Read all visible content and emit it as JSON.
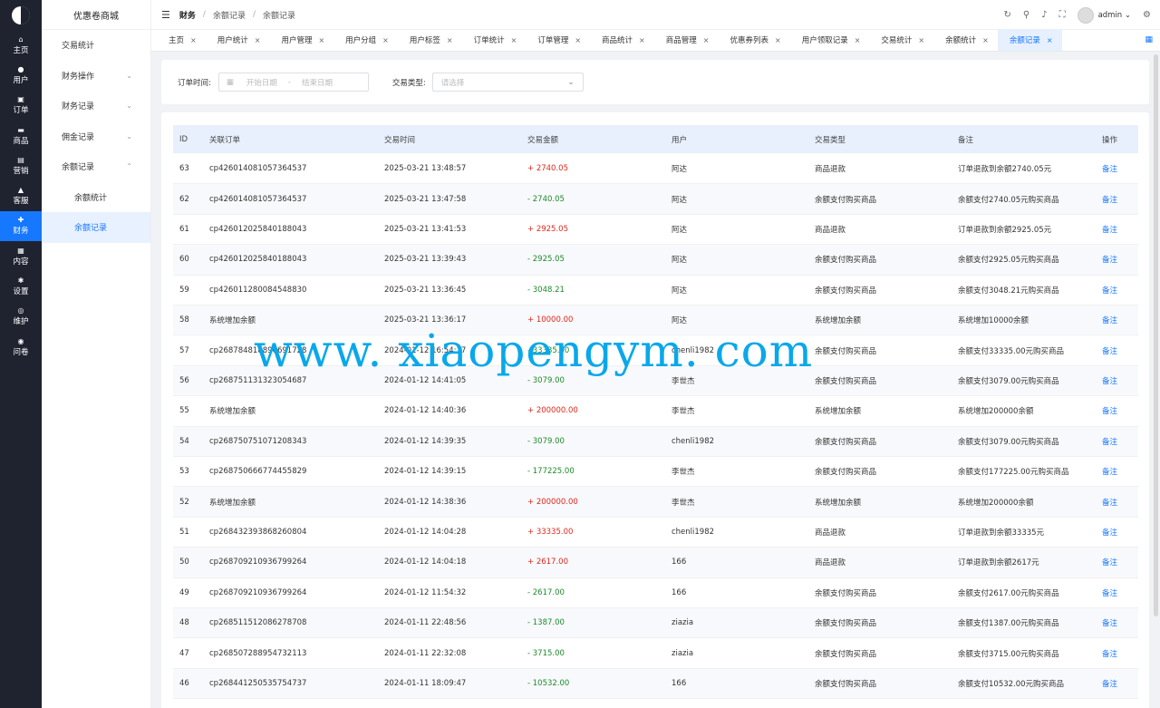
{
  "rail": {
    "items": [
      {
        "label": "主页",
        "icon": "⌂",
        "icon_name": "home-icon",
        "active": false
      },
      {
        "label": "用户",
        "icon": "●",
        "icon_name": "user-icon",
        "active": false
      },
      {
        "label": "订单",
        "icon": "▣",
        "icon_name": "order-icon",
        "active": false
      },
      {
        "label": "商品",
        "icon": "▬",
        "icon_name": "goods-icon",
        "active": false
      },
      {
        "label": "营销",
        "icon": "▤",
        "icon_name": "marketing-icon",
        "active": false
      },
      {
        "label": "客服",
        "icon": "▲",
        "icon_name": "service-icon",
        "active": false
      },
      {
        "label": "财务",
        "icon": "✚",
        "icon_name": "finance-icon",
        "active": true
      },
      {
        "label": "内容",
        "icon": "▦",
        "icon_name": "content-icon",
        "active": false
      },
      {
        "label": "设置",
        "icon": "✱",
        "icon_name": "settings-icon",
        "active": false
      },
      {
        "label": "维护",
        "icon": "◎",
        "icon_name": "maintenance-icon",
        "active": false
      },
      {
        "label": "问卷",
        "icon": "◉",
        "icon_name": "survey-icon",
        "active": false
      }
    ]
  },
  "submenu": {
    "brand": "优惠卷商城",
    "items": [
      {
        "label": "交易统计",
        "chevron": "",
        "sub": false,
        "active": false
      },
      {
        "label": "财务操作",
        "chevron": "⌄",
        "sub": false,
        "active": false
      },
      {
        "label": "财务记录",
        "chevron": "⌄",
        "sub": false,
        "active": false
      },
      {
        "label": "佣金记录",
        "chevron": "⌄",
        "sub": false,
        "active": false
      },
      {
        "label": "余额记录",
        "chevron": "⌃",
        "sub": false,
        "active": false
      },
      {
        "label": "余额统计",
        "chevron": "",
        "sub": true,
        "active": false
      },
      {
        "label": "余额记录",
        "chevron": "",
        "sub": true,
        "active": true
      }
    ]
  },
  "header": {
    "menu_icon": "☰",
    "breadcrumb": [
      "财务",
      "余额记录",
      "余额记录"
    ],
    "sep": "/",
    "username": "admin",
    "dropdown": "⌄",
    "icons": {
      "refresh": "↻",
      "search": "⚲",
      "bell": "♪",
      "fullscreen": "⛶",
      "settings": "⚙"
    }
  },
  "tabs": {
    "items": [
      {
        "label": "主页",
        "active": false
      },
      {
        "label": "用户统计",
        "active": false
      },
      {
        "label": "用户管理",
        "active": false
      },
      {
        "label": "用户分组",
        "active": false
      },
      {
        "label": "用户标签",
        "active": false
      },
      {
        "label": "订单统计",
        "active": false
      },
      {
        "label": "订单管理",
        "active": false
      },
      {
        "label": "商品统计",
        "active": false
      },
      {
        "label": "商品管理",
        "active": false
      },
      {
        "label": "优惠券列表",
        "active": false
      },
      {
        "label": "用户领取记录",
        "active": false
      },
      {
        "label": "交易统计",
        "active": false
      },
      {
        "label": "余额统计",
        "active": false
      },
      {
        "label": "余额记录",
        "active": true
      }
    ],
    "close": "×",
    "grid_icon": "▦"
  },
  "filter": {
    "order_time_label": "订单时间:",
    "date_icon": "▦",
    "start_placeholder": "开始日期",
    "range_sep": "-",
    "end_placeholder": "结束日期",
    "type_label": "交易类型:",
    "type_placeholder": "请选择",
    "select_chevron": "⌄"
  },
  "table": {
    "columns": [
      "ID",
      "关联订单",
      "交易时间",
      "交易金额",
      "用户",
      "交易类型",
      "备注",
      "操作"
    ],
    "action_label": "备注",
    "rows": [
      {
        "id": "63",
        "order": "cp426014081057364537",
        "time": "2025-03-21 13:48:57",
        "amount": "+ 2740.05",
        "sign": "pos",
        "user": "阿达",
        "type": "商品退款",
        "note": "订单退款到余额2740.05元"
      },
      {
        "id": "62",
        "order": "cp426014081057364537",
        "time": "2025-03-21 13:47:58",
        "amount": "- 2740.05",
        "sign": "neg",
        "user": "阿达",
        "type": "余额支付购买商品",
        "note": "余额支付2740.05元购买商品"
      },
      {
        "id": "61",
        "order": "cp426012025840188043",
        "time": "2025-03-21 13:41:53",
        "amount": "+ 2925.05",
        "sign": "pos",
        "user": "阿达",
        "type": "商品退款",
        "note": "订单退款到余额2925.05元"
      },
      {
        "id": "60",
        "order": "cp426012025840188043",
        "time": "2025-03-21 13:39:43",
        "amount": "- 2925.05",
        "sign": "neg",
        "user": "阿达",
        "type": "余额支付购买商品",
        "note": "余额支付2925.05元购买商品"
      },
      {
        "id": "59",
        "order": "cp426011280084548830",
        "time": "2025-03-21 13:36:45",
        "amount": "- 3048.21",
        "sign": "neg",
        "user": "阿达",
        "type": "余额支付购买商品",
        "note": "余额支付3048.21元购买商品"
      },
      {
        "id": "58",
        "order": "系统增加余额",
        "time": "2025-03-21 13:36:17",
        "amount": "+ 10000.00",
        "sign": "pos",
        "user": "阿达",
        "type": "系统增加余额",
        "note": "系统增加10000余额"
      },
      {
        "id": "57",
        "order": "cp268784818896691728",
        "time": "2024-01-12 16:54:17",
        "amount": "- 33335.00",
        "sign": "neg",
        "user": "chenli1982",
        "type": "余额支付购买商品",
        "note": "余额支付33335.00元购买商品"
      },
      {
        "id": "56",
        "order": "cp268751131323054687",
        "time": "2024-01-12 14:41:05",
        "amount": "- 3079.00",
        "sign": "neg",
        "user": "李世杰",
        "type": "余额支付购买商品",
        "note": "余额支付3079.00元购买商品"
      },
      {
        "id": "55",
        "order": "系统增加余额",
        "time": "2024-01-12 14:40:36",
        "amount": "+ 200000.00",
        "sign": "pos",
        "user": "李世杰",
        "type": "系统增加余额",
        "note": "系统增加200000余额"
      },
      {
        "id": "54",
        "order": "cp268750751071208343",
        "time": "2024-01-12 14:39:35",
        "amount": "- 3079.00",
        "sign": "neg",
        "user": "chenli1982",
        "type": "余额支付购买商品",
        "note": "余额支付3079.00元购买商品"
      },
      {
        "id": "53",
        "order": "cp268750666774455829",
        "time": "2024-01-12 14:39:15",
        "amount": "- 177225.00",
        "sign": "neg",
        "user": "李世杰",
        "type": "余额支付购买商品",
        "note": "余额支付177225.00元购买商品"
      },
      {
        "id": "52",
        "order": "系统增加余额",
        "time": "2024-01-12 14:38:36",
        "amount": "+ 200000.00",
        "sign": "pos",
        "user": "李世杰",
        "type": "系统增加余额",
        "note": "系统增加200000余额"
      },
      {
        "id": "51",
        "order": "cp268432393868260804",
        "time": "2024-01-12 14:04:28",
        "amount": "+ 33335.00",
        "sign": "pos",
        "user": "chenli1982",
        "type": "商品退款",
        "note": "订单退款到余额33335元"
      },
      {
        "id": "50",
        "order": "cp268709210936799264",
        "time": "2024-01-12 14:04:18",
        "amount": "+ 2617.00",
        "sign": "pos",
        "user": "166",
        "type": "商品退款",
        "note": "订单退款到余额2617元"
      },
      {
        "id": "49",
        "order": "cp268709210936799264",
        "time": "2024-01-12 11:54:32",
        "amount": "- 2617.00",
        "sign": "neg",
        "user": "166",
        "type": "余额支付购买商品",
        "note": "余额支付2617.00元购买商品"
      },
      {
        "id": "48",
        "order": "cp268511512086278708",
        "time": "2024-01-11 22:48:56",
        "amount": "- 1387.00",
        "sign": "neg",
        "user": "ziazia",
        "type": "余额支付购买商品",
        "note": "余额支付1387.00元购买商品"
      },
      {
        "id": "47",
        "order": "cp268507288954732113",
        "time": "2024-01-11 22:32:08",
        "amount": "- 3715.00",
        "sign": "neg",
        "user": "ziazia",
        "type": "余额支付购买商品",
        "note": "余额支付3715.00元购买商品"
      },
      {
        "id": "46",
        "order": "cp268441250535754737",
        "time": "2024-01-11 18:09:47",
        "amount": "- 10532.00",
        "sign": "neg",
        "user": "166",
        "type": "余额支付购买商品",
        "note": "余额支付10532.00元购买商品"
      }
    ]
  },
  "watermark": "www. xiaopengym. com",
  "colors": {
    "accent": "#1677ff",
    "positive": "#e0281c",
    "negative": "#1e8a2c",
    "rail_bg": "#1f2330",
    "watermark": "#0aa8ea"
  }
}
